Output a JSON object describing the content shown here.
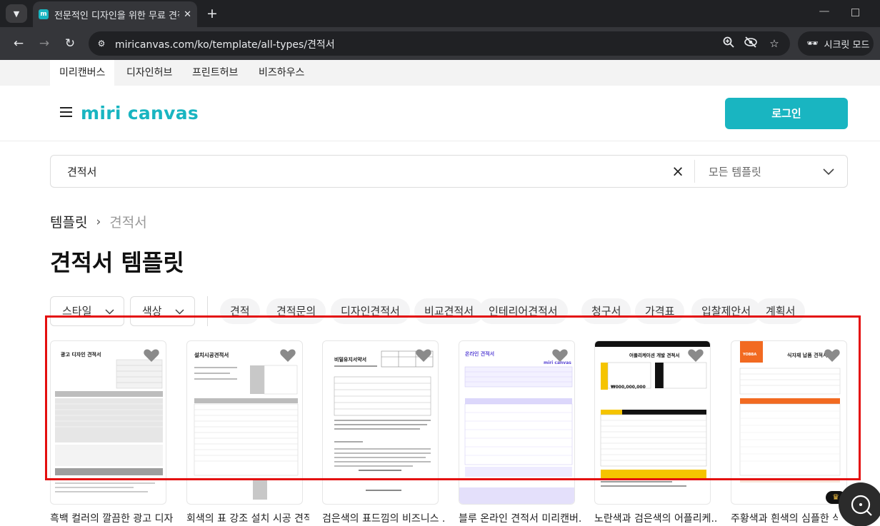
{
  "browser": {
    "tab_title": "전문적인 디자인을 위한 무료 견적서 템플릿",
    "url": "miricanvas.com/ko/template/all-types/견적서",
    "incognito_label": "시크릿 모드",
    "icons": {
      "tab_menu": "chevron-down-icon",
      "favicon": "miricanvas-favicon",
      "close": "close-icon",
      "new_tab": "plus-icon",
      "back": "back-arrow-icon",
      "forward": "forward-arrow-icon",
      "reload": "reload-icon",
      "site_info": "tune-icon",
      "zoom": "zoom-icon",
      "eye_off": "eye-off-icon",
      "bookmark": "star-icon",
      "incognito": "incognito-icon"
    }
  },
  "topnav": {
    "items": [
      "미리캔버스",
      "디자인허브",
      "프린트허브",
      "비즈하우스"
    ]
  },
  "header": {
    "logo_text": "miri canvas",
    "login_label": "로그인",
    "brand_color": "#19b5c1"
  },
  "search": {
    "value": "견적서",
    "type_label": "모든 템플릿"
  },
  "breadcrumb": {
    "root": "템플릿",
    "current": "견적서"
  },
  "page_title": "견적서 템플릿",
  "filters": {
    "style_label": "스타일",
    "color_label": "색상",
    "chips": [
      "견적",
      "견적문의",
      "디자인견적서",
      "비교견적서",
      "인테리어견적서",
      "청구서",
      "가격표",
      "입찰제안서",
      "계획서"
    ]
  },
  "templates": [
    {
      "caption": "흑백 컬러의 깔끔한 광고 디자...",
      "doc_title": "광고 디자인 견적서"
    },
    {
      "caption": "회색의 표 강조 설치 시공 견적...",
      "doc_title": "설치시공견적서"
    },
    {
      "caption": "검은색의 표드낌의 비즈니스 ...",
      "doc_title": "비밀유지서약서"
    },
    {
      "caption": "블루 온라인 견적서 미리캔버...",
      "doc_title": "온라인 견적서",
      "doc_brand": "miri canvas"
    },
    {
      "caption": "노란색과 검은색의 어플리케...",
      "doc_title": "어플리케이션 개발 견적서",
      "doc_amount": "₩000,000,000"
    },
    {
      "caption": "주황색과 흰색의 심플한 식자...",
      "doc_title": "식자재 납품 견적서",
      "doc_brand": "YOBBA"
    }
  ],
  "highlight_color": "#e40f0f"
}
